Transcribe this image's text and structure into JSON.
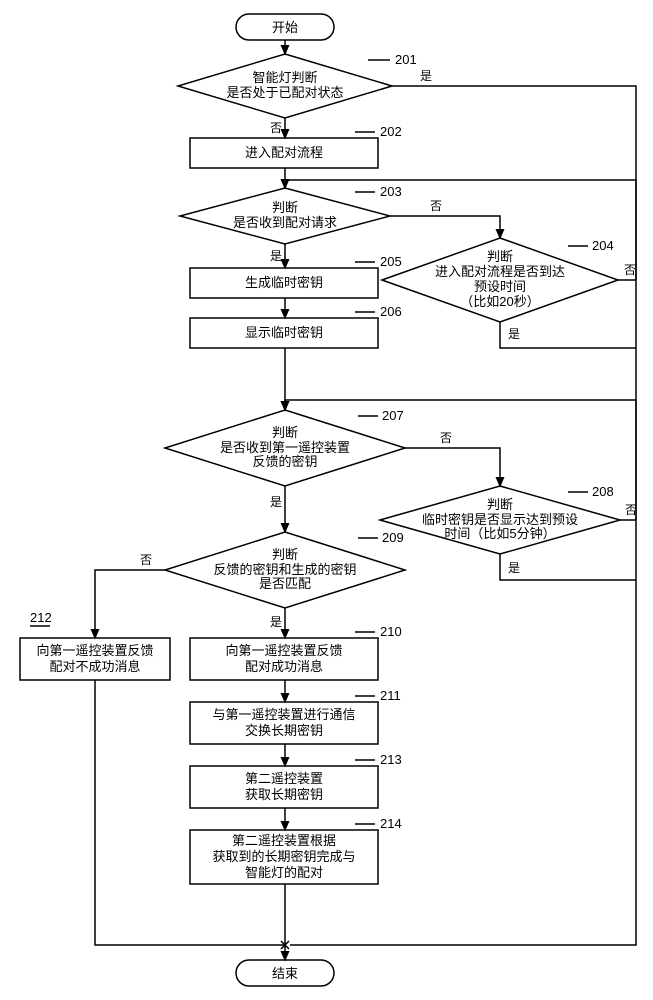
{
  "chart_data": {
    "type": "flowchart",
    "title": "",
    "layout_hint": "vertical main path with two right-side timeout decisions",
    "nodes": [
      {
        "id": "start",
        "type": "terminator",
        "label": "开始"
      },
      {
        "id": "201",
        "type": "decision",
        "step": "201",
        "label": "智能灯判断\n是否处于已配对状态",
        "yes_label": "是",
        "no_label": "否"
      },
      {
        "id": "202",
        "type": "process",
        "step": "202",
        "label": "进入配对流程"
      },
      {
        "id": "203",
        "type": "decision",
        "step": "203",
        "label": "判断\n是否收到配对请求",
        "yes_label": "是",
        "no_label": "否"
      },
      {
        "id": "204",
        "type": "decision",
        "step": "204",
        "label": "判断\n进入配对流程是否到达\n预设时间\n（比如20秒）",
        "yes_label": "是",
        "no_label": "否"
      },
      {
        "id": "205",
        "type": "process",
        "step": "205",
        "label": "生成临时密钥"
      },
      {
        "id": "206",
        "type": "process",
        "step": "206",
        "label": "显示临时密钥"
      },
      {
        "id": "207",
        "type": "decision",
        "step": "207",
        "label": "判断\n是否收到第一遥控装置\n反馈的密钥",
        "yes_label": "是",
        "no_label": "否"
      },
      {
        "id": "208",
        "type": "decision",
        "step": "208",
        "label": "判断\n临时密钥是否显示达到预设\n时间（比如5分钟）",
        "yes_label": "是",
        "no_label": "否"
      },
      {
        "id": "209",
        "type": "decision",
        "step": "209",
        "label": "判断\n反馈的密钥和生成的密钥\n是否匹配",
        "yes_label": "是",
        "no_label": "否"
      },
      {
        "id": "210",
        "type": "process",
        "step": "210",
        "label": "向第一遥控装置反馈\n配对成功消息"
      },
      {
        "id": "211",
        "type": "process",
        "step": "211",
        "label": "与第一遥控装置进行通信\n交换长期密钥"
      },
      {
        "id": "212",
        "type": "process",
        "step": "212",
        "label": "向第一遥控装置反馈\n配对不成功消息"
      },
      {
        "id": "213",
        "type": "process",
        "step": "213",
        "label": "第二遥控装置\n获取长期密钥"
      },
      {
        "id": "214",
        "type": "process",
        "step": "214",
        "label": "第二遥控装置根据\n获取到的长期密钥完成与\n智能灯的配对"
      },
      {
        "id": "end",
        "type": "terminator",
        "label": "结束"
      }
    ],
    "edges": [
      {
        "from": "start",
        "to": "201"
      },
      {
        "from": "201",
        "to": "end",
        "label": "是",
        "route": "right-down"
      },
      {
        "from": "201",
        "to": "202",
        "label": "否"
      },
      {
        "from": "202",
        "to": "203"
      },
      {
        "from": "203",
        "to": "205",
        "label": "是"
      },
      {
        "from": "203",
        "to": "204",
        "label": "否"
      },
      {
        "from": "204",
        "to": "end",
        "label": "是",
        "route": "right-down"
      },
      {
        "from": "204",
        "to": "203",
        "label": "否",
        "route": "up-loop"
      },
      {
        "from": "205",
        "to": "206"
      },
      {
        "from": "206",
        "to": "207"
      },
      {
        "from": "207",
        "to": "209",
        "label": "是"
      },
      {
        "from": "207",
        "to": "208",
        "label": "否"
      },
      {
        "from": "208",
        "to": "end",
        "label": "是",
        "route": "right-down"
      },
      {
        "from": "208",
        "to": "207",
        "label": "否",
        "route": "up-loop"
      },
      {
        "from": "209",
        "to": "210",
        "label": "是"
      },
      {
        "from": "209",
        "to": "212",
        "label": "否"
      },
      {
        "from": "210",
        "to": "211"
      },
      {
        "from": "211",
        "to": "213"
      },
      {
        "from": "213",
        "to": "214"
      },
      {
        "from": "214",
        "to": "end"
      },
      {
        "from": "212",
        "to": "end",
        "route": "down"
      }
    ]
  },
  "labels": {
    "start": "开始",
    "end": "结束",
    "yes": "是",
    "no": "否",
    "n201": "智能灯判断\n是否处于已配对状态",
    "n202": "进入配对流程",
    "n203": "判断\n是否收到配对请求",
    "n204": "判断\n进入配对流程是否到达\n预设时间\n（比如20秒）",
    "n205": "生成临时密钥",
    "n206": "显示临时密钥",
    "n207": "判断\n是否收到第一遥控装置\n反馈的密钥",
    "n208": "判断\n临时密钥是否显示达到预设\n时间（比如5分钟）",
    "n209": "判断\n反馈的密钥和生成的密钥\n是否匹配",
    "n210": "向第一遥控装置反馈\n配对成功消息",
    "n211": "与第一遥控装置进行通信\n交换长期密钥",
    "n212": "向第一遥控装置反馈\n配对不成功消息",
    "n213": "第二遥控装置\n获取长期密钥",
    "n214": "第二遥控装置根据\n获取到的长期密钥完成与\n智能灯的配对"
  },
  "steps": {
    "s201": "201",
    "s202": "202",
    "s203": "203",
    "s204": "204",
    "s205": "205",
    "s206": "206",
    "s207": "207",
    "s208": "208",
    "s209": "209",
    "s210": "210",
    "s211": "211",
    "s212": "212",
    "s213": "213",
    "s214": "214"
  }
}
